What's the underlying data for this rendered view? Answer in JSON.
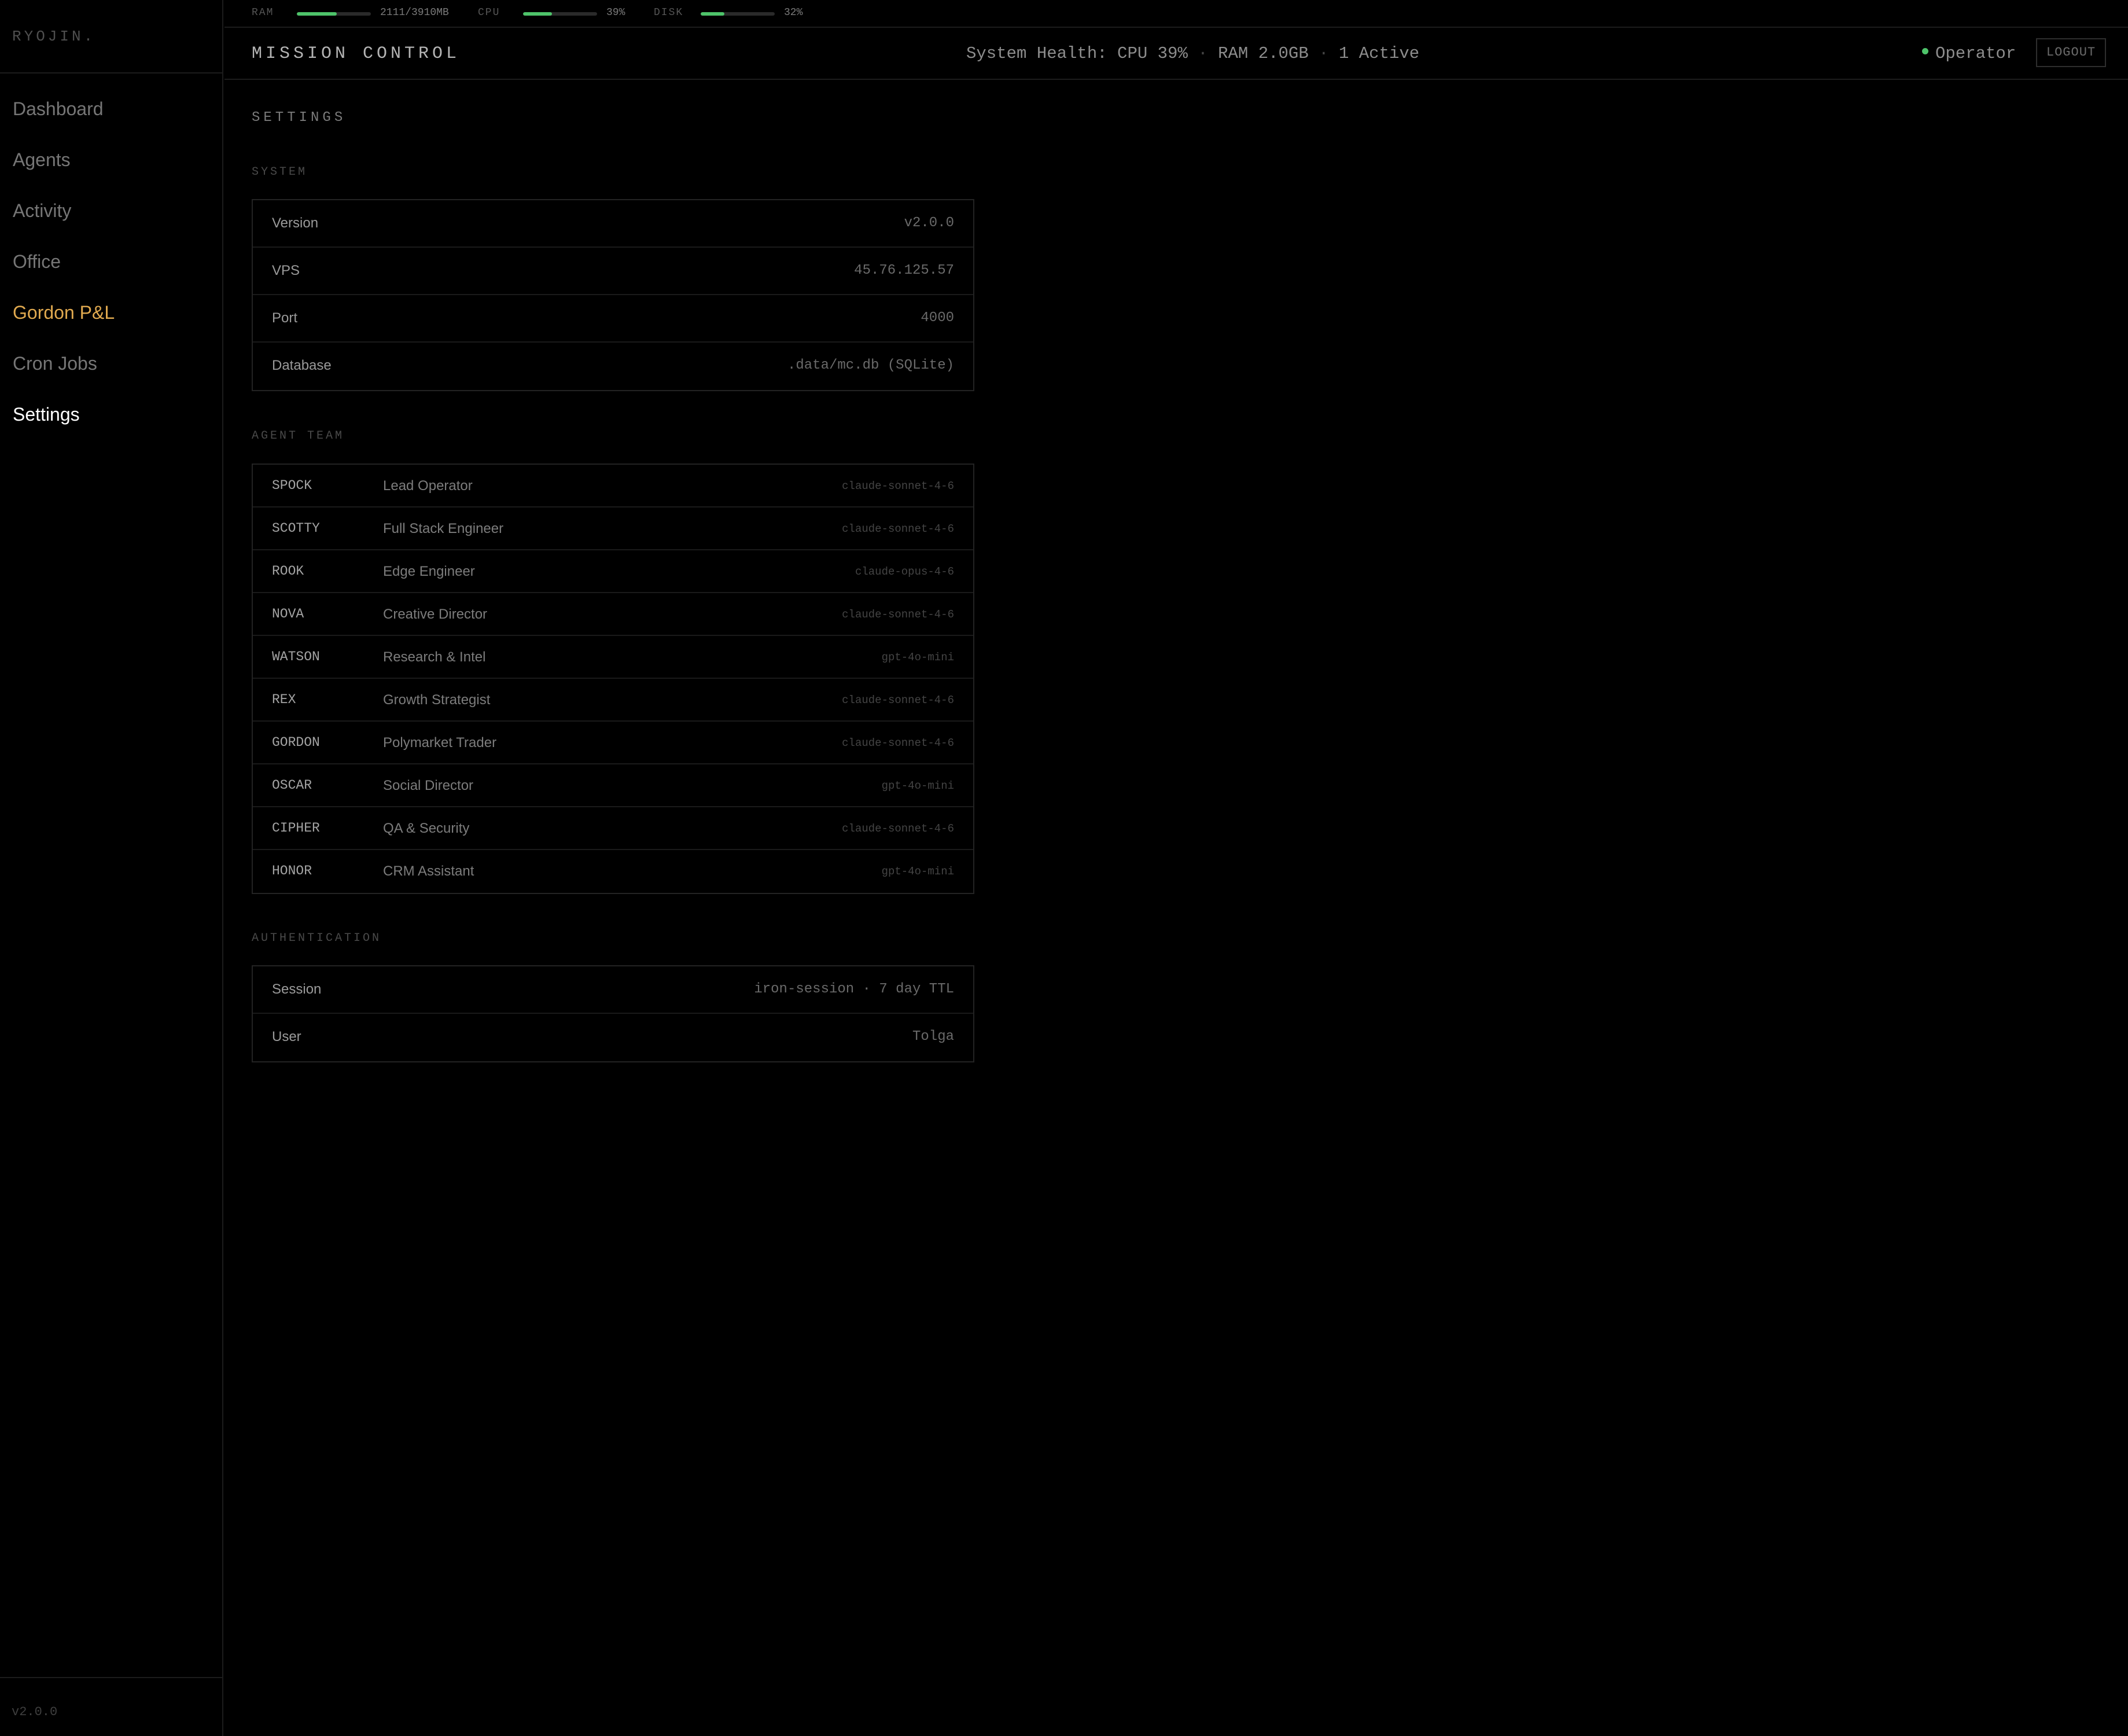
{
  "sidebar": {
    "brand": "RYOJIN.",
    "items": [
      {
        "label": "Dashboard"
      },
      {
        "label": "Agents"
      },
      {
        "label": "Activity"
      },
      {
        "label": "Office"
      },
      {
        "label": "Gordon P&L"
      },
      {
        "label": "Cron Jobs"
      },
      {
        "label": "Settings"
      }
    ],
    "version": "v2.0.0"
  },
  "resources": {
    "ram": {
      "label": "RAM",
      "value": "2111/3910MB",
      "level": 0.54
    },
    "cpu": {
      "label": "CPU",
      "value": "39%",
      "level": 0.39
    },
    "disk": {
      "label": "DISK",
      "value": "32%",
      "level": 0.32
    },
    "bar_color": "#4ec36a"
  },
  "header": {
    "title": "MISSION CONTROL",
    "health_label": "System Health:",
    "cpu": "CPU 39%",
    "ram": "RAM 2.0GB",
    "active": "1 Active",
    "separator": "·",
    "operator": "Operator",
    "logout": "LOGOUT"
  },
  "page": {
    "title": "SETTINGS"
  },
  "system": {
    "label": "SYSTEM",
    "rows": [
      {
        "key": "Version",
        "value": "v2.0.0"
      },
      {
        "key": "VPS",
        "value": "45.76.125.57"
      },
      {
        "key": "Port",
        "value": "4000"
      },
      {
        "key": "Database",
        "value": ".data/mc.db (SQLite)"
      }
    ]
  },
  "agent_team": {
    "label": "AGENT TEAM",
    "agents": [
      {
        "name": "SPOCK",
        "role": "Lead Operator",
        "model": "claude-sonnet-4-6"
      },
      {
        "name": "SCOTTY",
        "role": "Full Stack Engineer",
        "model": "claude-sonnet-4-6"
      },
      {
        "name": "ROOK",
        "role": "Edge Engineer",
        "model": "claude-opus-4-6"
      },
      {
        "name": "NOVA",
        "role": "Creative Director",
        "model": "claude-sonnet-4-6"
      },
      {
        "name": "WATSON",
        "role": "Research & Intel",
        "model": "gpt-4o-mini"
      },
      {
        "name": "REX",
        "role": "Growth Strategist",
        "model": "claude-sonnet-4-6"
      },
      {
        "name": "GORDON",
        "role": "Polymarket Trader",
        "model": "claude-sonnet-4-6"
      },
      {
        "name": "OSCAR",
        "role": "Social Director",
        "model": "gpt-4o-mini"
      },
      {
        "name": "CIPHER",
        "role": "QA & Security",
        "model": "claude-sonnet-4-6"
      },
      {
        "name": "HONOR",
        "role": "CRM Assistant",
        "model": "gpt-4o-mini"
      }
    ]
  },
  "authentication": {
    "label": "AUTHENTICATION",
    "rows": [
      {
        "key": "Session",
        "value": "iron-session · 7 day TTL"
      },
      {
        "key": "User",
        "value": "Tolga"
      }
    ]
  },
  "colors": {
    "accent_active_nav": "#ffffff",
    "accent_highlight_nav": "#e0a94f",
    "status_green": "#4ec36a"
  }
}
